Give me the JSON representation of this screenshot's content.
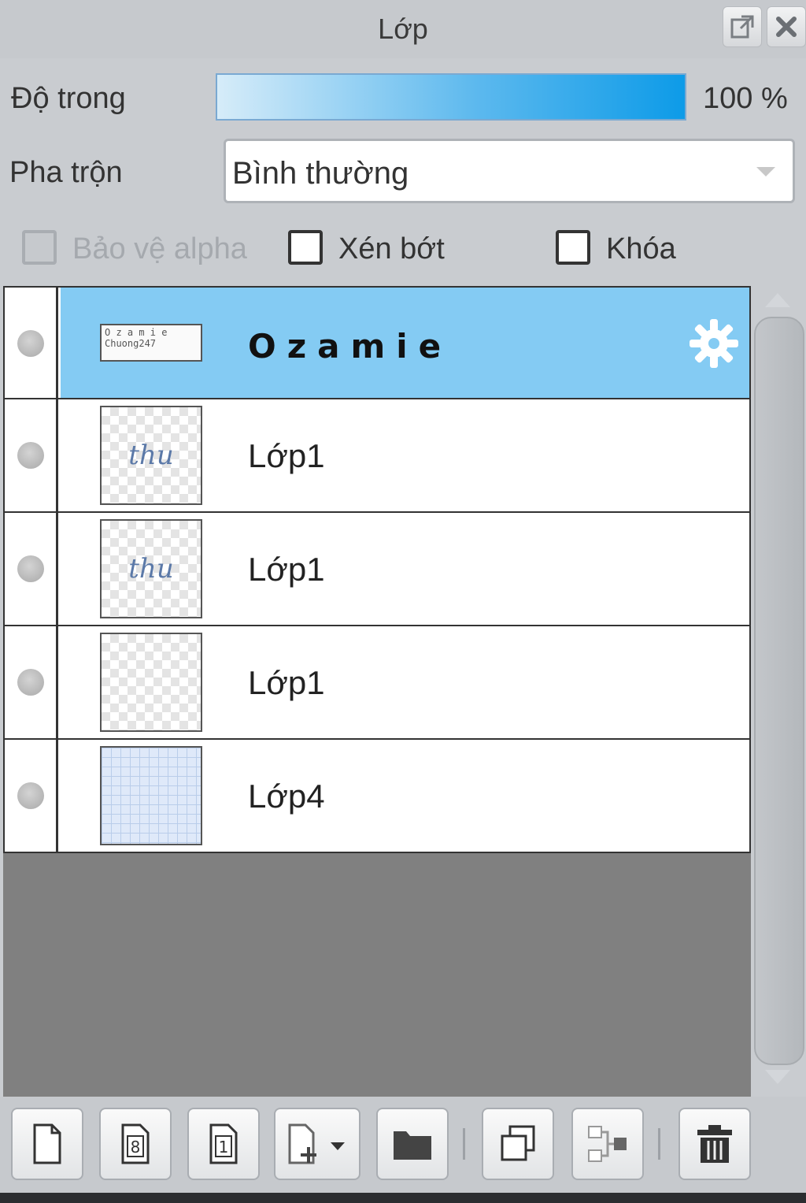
{
  "panel": {
    "title": "Lớp"
  },
  "title_buttons": [
    {
      "name": "popout-icon"
    },
    {
      "name": "close-icon"
    }
  ],
  "opacity": {
    "label": "Độ trong",
    "value_text": "100 %",
    "level_percent": 100
  },
  "blend": {
    "label": "Pha trộn",
    "value": "Bình thường"
  },
  "options": {
    "protect_alpha": {
      "label": "Bảo vệ alpha",
      "checked": false,
      "disabled": true
    },
    "clipping": {
      "label": "Xén bớt",
      "checked": false
    },
    "lock": {
      "label": "Khóa",
      "checked": false
    }
  },
  "layers": [
    {
      "name": "Ozamie",
      "selected": true,
      "thumb": "text",
      "thumb_text": "O z a m i e",
      "thumb_text2": "Chuong247",
      "has_settings": true
    },
    {
      "name": "Lớp1",
      "selected": false,
      "thumb": "script",
      "thumb_text": "thu"
    },
    {
      "name": "Lớp1",
      "selected": false,
      "thumb": "script",
      "thumb_text": "thu"
    },
    {
      "name": "Lớp1",
      "selected": false,
      "thumb": "empty"
    },
    {
      "name": "Lớp4",
      "selected": false,
      "thumb": "grid"
    }
  ],
  "toolbar": [
    {
      "name": "new-layer-icon"
    },
    {
      "name": "new-8bit-layer-icon"
    },
    {
      "name": "new-1bit-layer-icon"
    },
    {
      "name": "add-layer-menu-icon"
    },
    {
      "name": "new-folder-icon"
    },
    {
      "name": "duplicate-layer-icon"
    },
    {
      "name": "merge-layer-icon"
    },
    {
      "name": "delete-layer-icon"
    }
  ],
  "colors": {
    "selected_row": "#84cbf3",
    "opacity_fill": "#0d9be8",
    "panel_bg": "#c9ccd0"
  }
}
